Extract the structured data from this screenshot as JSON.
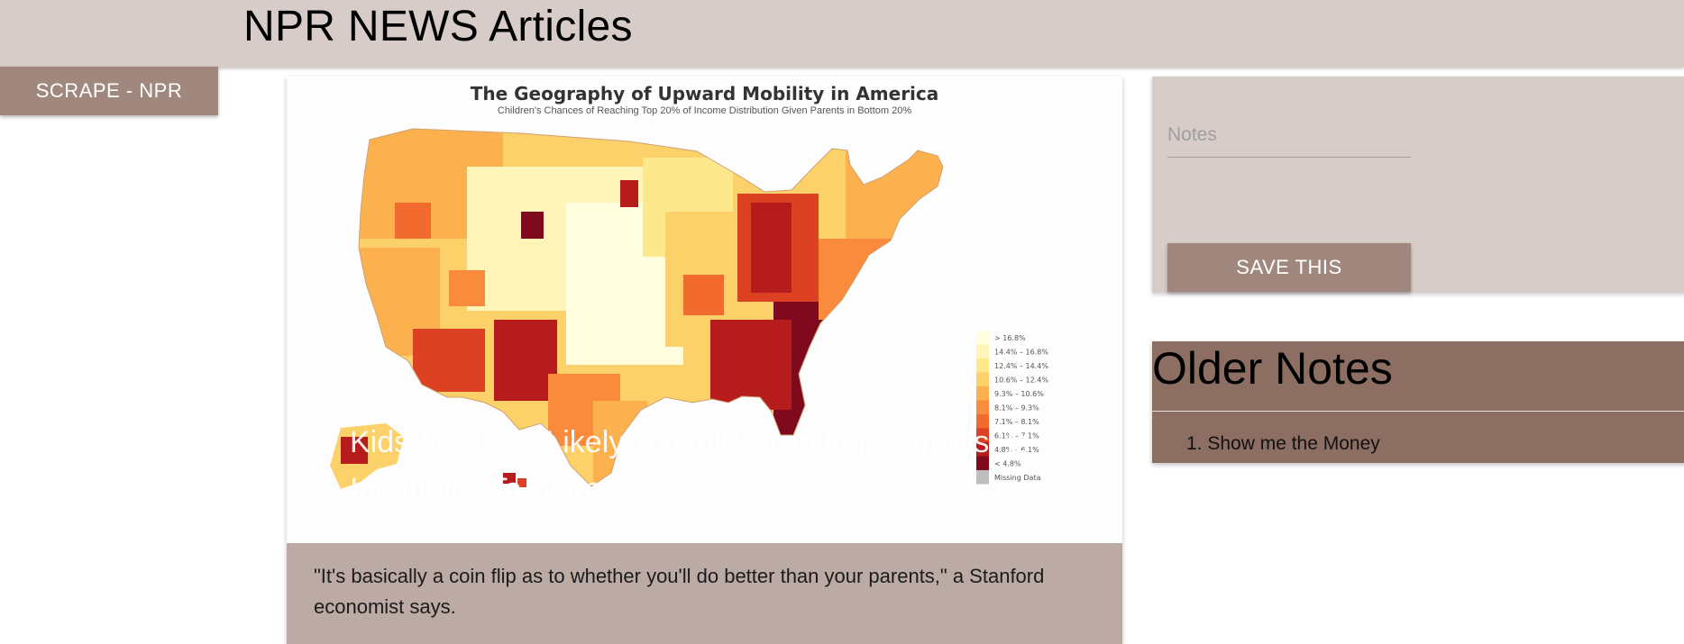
{
  "header": {
    "title": "NPR NEWS Articles"
  },
  "toolbar": {
    "scrape_label": "SCRAPE - NPR"
  },
  "article": {
    "image": {
      "title": "The Geography of Upward Mobility in America",
      "subtitle": "Children's Chances of Reaching Top 20% of Income Distribution Given Parents in Bottom 20%",
      "legend": [
        {
          "label": "> 16.8%",
          "color": "#ffffe0"
        },
        {
          "label": "14.4% – 16.8%",
          "color": "#fff5b8"
        },
        {
          "label": "12.4% – 14.4%",
          "color": "#fee88c"
        },
        {
          "label": "10.6% – 12.4%",
          "color": "#fdd16a"
        },
        {
          "label": "9.3% – 10.6%",
          "color": "#fdb14e"
        },
        {
          "label": "8.1% – 9.3%",
          "color": "#fb8b3c"
        },
        {
          "label": "7.1% – 8.1%",
          "color": "#f26a2e"
        },
        {
          "label": "6.1% – 7.1%",
          "color": "#dd4124"
        },
        {
          "label": "4.8% – 6.1%",
          "color": "#b71c1c"
        },
        {
          "label": "< 4.8%",
          "color": "#7f0a1d"
        },
        {
          "label": "Missing Data",
          "color": "#bdbdbd"
        }
      ]
    },
    "title": "Kids Are Less Likely To Out-Earn Their Parents. Is Inequality To Blame?",
    "summary": "\"It's basically a coin flip as to whether you'll do better than your parents,\" a Stanford economist says."
  },
  "notes": {
    "placeholder": "Notes",
    "value": "",
    "save_label": "SAVE THIS"
  },
  "older_notes": {
    "heading": "Older Notes",
    "items": [
      "1. Show me the Money"
    ]
  },
  "colors": {
    "topbar": "#d7ccc8",
    "button": "#a1887f",
    "older_panel": "#8d6e63",
    "card_content": "#bcaaa4"
  }
}
